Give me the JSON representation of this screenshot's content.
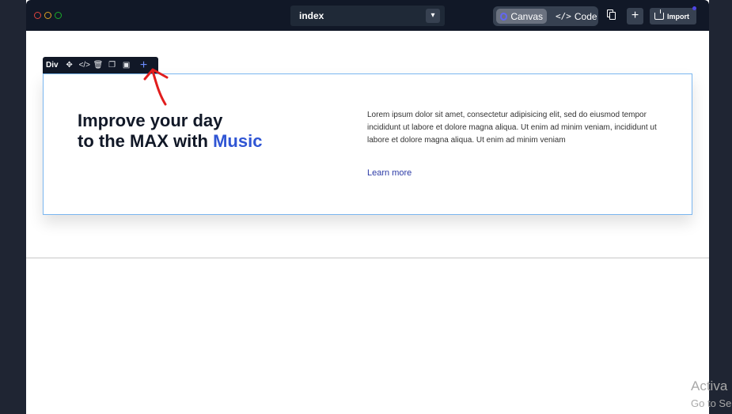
{
  "topbar": {
    "page_selector": {
      "value": "index",
      "icon": "chevron-down-icon"
    },
    "mode": {
      "canvas_label": "Canvas",
      "code_label": "Code",
      "active": "Canvas"
    },
    "actions": {
      "copy_icon": "copy-icon",
      "add_icon": "plus-icon",
      "import_label": "Import"
    }
  },
  "element_toolbar": {
    "tag": "Div",
    "icons": [
      "move-icon",
      "code-icon",
      "trash-icon",
      "duplicate-icon",
      "ai-robot-icon",
      "plus-icon"
    ]
  },
  "hero": {
    "heading_line1": "Improve your day",
    "heading_line2": "to the MAX with ",
    "heading_accent": "Music",
    "paragraph": "Lorem ipsum dolor sit amet, consectetur adipisicing elit, sed do eiusmod tempor incididunt ut labore et dolore magna aliqua. Ut enim ad minim veniam, incididunt ut labore et dolore magna aliqua. Ut enim ad minim veniam",
    "link": "Learn more"
  },
  "watermark": {
    "line1": "Activa",
    "line2": "Go to Se"
  },
  "colors": {
    "accent": "#2f55d4",
    "selection_border": "#7ab6f0",
    "topbar_bg": "#111827"
  }
}
